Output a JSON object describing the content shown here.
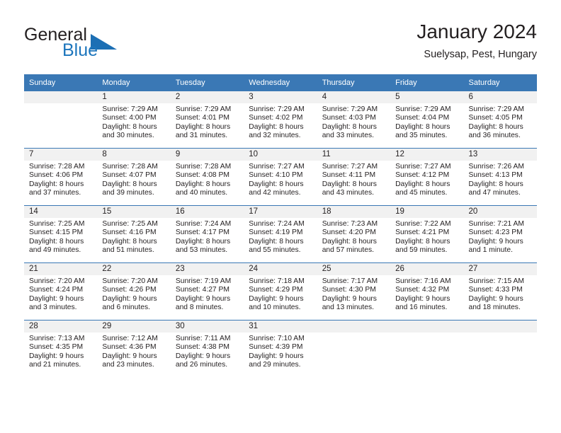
{
  "brand": {
    "name_part1": "General",
    "name_part2": "Blue",
    "colors": {
      "blue": "#1c75bc",
      "header_blue": "#3a78b5",
      "daynum_band": "#f1f1f1",
      "text": "#231f20"
    }
  },
  "header": {
    "month_title": "January 2024",
    "location": "Suelysap, Pest, Hungary"
  },
  "weekdays": [
    "Sunday",
    "Monday",
    "Tuesday",
    "Wednesday",
    "Thursday",
    "Friday",
    "Saturday"
  ],
  "weeks": [
    [
      {
        "day": "",
        "sunrise": "",
        "sunset": "",
        "daylight": ""
      },
      {
        "day": "1",
        "sunrise": "Sunrise: 7:29 AM",
        "sunset": "Sunset: 4:00 PM",
        "daylight": "Daylight: 8 hours and 30 minutes."
      },
      {
        "day": "2",
        "sunrise": "Sunrise: 7:29 AM",
        "sunset": "Sunset: 4:01 PM",
        "daylight": "Daylight: 8 hours and 31 minutes."
      },
      {
        "day": "3",
        "sunrise": "Sunrise: 7:29 AM",
        "sunset": "Sunset: 4:02 PM",
        "daylight": "Daylight: 8 hours and 32 minutes."
      },
      {
        "day": "4",
        "sunrise": "Sunrise: 7:29 AM",
        "sunset": "Sunset: 4:03 PM",
        "daylight": "Daylight: 8 hours and 33 minutes."
      },
      {
        "day": "5",
        "sunrise": "Sunrise: 7:29 AM",
        "sunset": "Sunset: 4:04 PM",
        "daylight": "Daylight: 8 hours and 35 minutes."
      },
      {
        "day": "6",
        "sunrise": "Sunrise: 7:29 AM",
        "sunset": "Sunset: 4:05 PM",
        "daylight": "Daylight: 8 hours and 36 minutes."
      }
    ],
    [
      {
        "day": "7",
        "sunrise": "Sunrise: 7:28 AM",
        "sunset": "Sunset: 4:06 PM",
        "daylight": "Daylight: 8 hours and 37 minutes."
      },
      {
        "day": "8",
        "sunrise": "Sunrise: 7:28 AM",
        "sunset": "Sunset: 4:07 PM",
        "daylight": "Daylight: 8 hours and 39 minutes."
      },
      {
        "day": "9",
        "sunrise": "Sunrise: 7:28 AM",
        "sunset": "Sunset: 4:08 PM",
        "daylight": "Daylight: 8 hours and 40 minutes."
      },
      {
        "day": "10",
        "sunrise": "Sunrise: 7:27 AM",
        "sunset": "Sunset: 4:10 PM",
        "daylight": "Daylight: 8 hours and 42 minutes."
      },
      {
        "day": "11",
        "sunrise": "Sunrise: 7:27 AM",
        "sunset": "Sunset: 4:11 PM",
        "daylight": "Daylight: 8 hours and 43 minutes."
      },
      {
        "day": "12",
        "sunrise": "Sunrise: 7:27 AM",
        "sunset": "Sunset: 4:12 PM",
        "daylight": "Daylight: 8 hours and 45 minutes."
      },
      {
        "day": "13",
        "sunrise": "Sunrise: 7:26 AM",
        "sunset": "Sunset: 4:13 PM",
        "daylight": "Daylight: 8 hours and 47 minutes."
      }
    ],
    [
      {
        "day": "14",
        "sunrise": "Sunrise: 7:25 AM",
        "sunset": "Sunset: 4:15 PM",
        "daylight": "Daylight: 8 hours and 49 minutes."
      },
      {
        "day": "15",
        "sunrise": "Sunrise: 7:25 AM",
        "sunset": "Sunset: 4:16 PM",
        "daylight": "Daylight: 8 hours and 51 minutes."
      },
      {
        "day": "16",
        "sunrise": "Sunrise: 7:24 AM",
        "sunset": "Sunset: 4:17 PM",
        "daylight": "Daylight: 8 hours and 53 minutes."
      },
      {
        "day": "17",
        "sunrise": "Sunrise: 7:24 AM",
        "sunset": "Sunset: 4:19 PM",
        "daylight": "Daylight: 8 hours and 55 minutes."
      },
      {
        "day": "18",
        "sunrise": "Sunrise: 7:23 AM",
        "sunset": "Sunset: 4:20 PM",
        "daylight": "Daylight: 8 hours and 57 minutes."
      },
      {
        "day": "19",
        "sunrise": "Sunrise: 7:22 AM",
        "sunset": "Sunset: 4:21 PM",
        "daylight": "Daylight: 8 hours and 59 minutes."
      },
      {
        "day": "20",
        "sunrise": "Sunrise: 7:21 AM",
        "sunset": "Sunset: 4:23 PM",
        "daylight": "Daylight: 9 hours and 1 minute."
      }
    ],
    [
      {
        "day": "21",
        "sunrise": "Sunrise: 7:20 AM",
        "sunset": "Sunset: 4:24 PM",
        "daylight": "Daylight: 9 hours and 3 minutes."
      },
      {
        "day": "22",
        "sunrise": "Sunrise: 7:20 AM",
        "sunset": "Sunset: 4:26 PM",
        "daylight": "Daylight: 9 hours and 6 minutes."
      },
      {
        "day": "23",
        "sunrise": "Sunrise: 7:19 AM",
        "sunset": "Sunset: 4:27 PM",
        "daylight": "Daylight: 9 hours and 8 minutes."
      },
      {
        "day": "24",
        "sunrise": "Sunrise: 7:18 AM",
        "sunset": "Sunset: 4:29 PM",
        "daylight": "Daylight: 9 hours and 10 minutes."
      },
      {
        "day": "25",
        "sunrise": "Sunrise: 7:17 AM",
        "sunset": "Sunset: 4:30 PM",
        "daylight": "Daylight: 9 hours and 13 minutes."
      },
      {
        "day": "26",
        "sunrise": "Sunrise: 7:16 AM",
        "sunset": "Sunset: 4:32 PM",
        "daylight": "Daylight: 9 hours and 16 minutes."
      },
      {
        "day": "27",
        "sunrise": "Sunrise: 7:15 AM",
        "sunset": "Sunset: 4:33 PM",
        "daylight": "Daylight: 9 hours and 18 minutes."
      }
    ],
    [
      {
        "day": "28",
        "sunrise": "Sunrise: 7:13 AM",
        "sunset": "Sunset: 4:35 PM",
        "daylight": "Daylight: 9 hours and 21 minutes."
      },
      {
        "day": "29",
        "sunrise": "Sunrise: 7:12 AM",
        "sunset": "Sunset: 4:36 PM",
        "daylight": "Daylight: 9 hours and 23 minutes."
      },
      {
        "day": "30",
        "sunrise": "Sunrise: 7:11 AM",
        "sunset": "Sunset: 4:38 PM",
        "daylight": "Daylight: 9 hours and 26 minutes."
      },
      {
        "day": "31",
        "sunrise": "Sunrise: 7:10 AM",
        "sunset": "Sunset: 4:39 PM",
        "daylight": "Daylight: 9 hours and 29 minutes."
      },
      {
        "day": "",
        "sunrise": "",
        "sunset": "",
        "daylight": ""
      },
      {
        "day": "",
        "sunrise": "",
        "sunset": "",
        "daylight": ""
      },
      {
        "day": "",
        "sunrise": "",
        "sunset": "",
        "daylight": ""
      }
    ]
  ]
}
